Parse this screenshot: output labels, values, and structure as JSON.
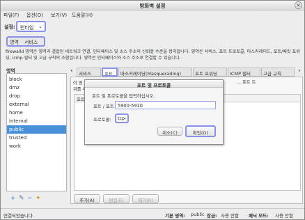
{
  "window": {
    "title": "방화벽 설정",
    "close_glyph": "×"
  },
  "menu": [
    "파일(F)",
    "옵션(O)",
    "보기(V)",
    "도움말(H)"
  ],
  "config": {
    "label": "설정:",
    "value": "런타임"
  },
  "view_tabs": [
    "영역",
    "서비스"
  ],
  "description": "firewalld 영역은 영역과 결합된 네트워크 연결, 인터페이스 및 소스 주소의 신뢰할 수준을 정의합니다. 영역은 서비스, 포트 프로토콜, 마스커레이드, 포트/패킷 포워딩, icmp 필터 및 고급 규칙의 조합입니다. 영역은 인터페이스와 소스 주소로 연결할 수 있습니다.",
  "zones": {
    "label": "영역",
    "items": [
      "block",
      "dmz",
      "drop",
      "external",
      "home",
      "internal",
      "public",
      "trusted",
      "work"
    ],
    "selected": "public",
    "toolbar_icons": [
      "add-icon",
      "edit-icon",
      "remove-icon",
      "load-defaults-icon"
    ]
  },
  "tabs": [
    "서비스",
    "포트",
    "마스커레이딩(Masquerading)",
    "포트 포워딩",
    "ICMP 필터",
    "고급 규칙"
  ],
  "active_tab": "포트",
  "nav": {
    "prev": "‹",
    "next": "›"
  },
  "ports_panel": {
    "text_left": "이 영",
    "text_right": "... 포트 트",
    "text_right2": "위를 추",
    "column_header": "포트",
    "buttons": {
      "add": "추가(A)",
      "edit": "편집(E)",
      "remove": "제거(R)"
    }
  },
  "dialog": {
    "title": "포트 및 프로토콜",
    "instruction": "포트 및 프로토콜을 입력하십시오.",
    "port_label": "포트 / 포트 범위:",
    "port_value": "5900-5910",
    "protocol_label": "프로토콜:",
    "protocol_value": "tcp",
    "cancel": "취소(C)",
    "ok": "확인(O)"
  },
  "status": {
    "connection": "연결되었습니다.",
    "default_zone_label": "기본 영역:",
    "default_zone": "public",
    "lockdown_label": "잠금:",
    "lockdown": "사용 안함",
    "panic_label": "패닉 모드:",
    "panic": "사용 안함"
  }
}
